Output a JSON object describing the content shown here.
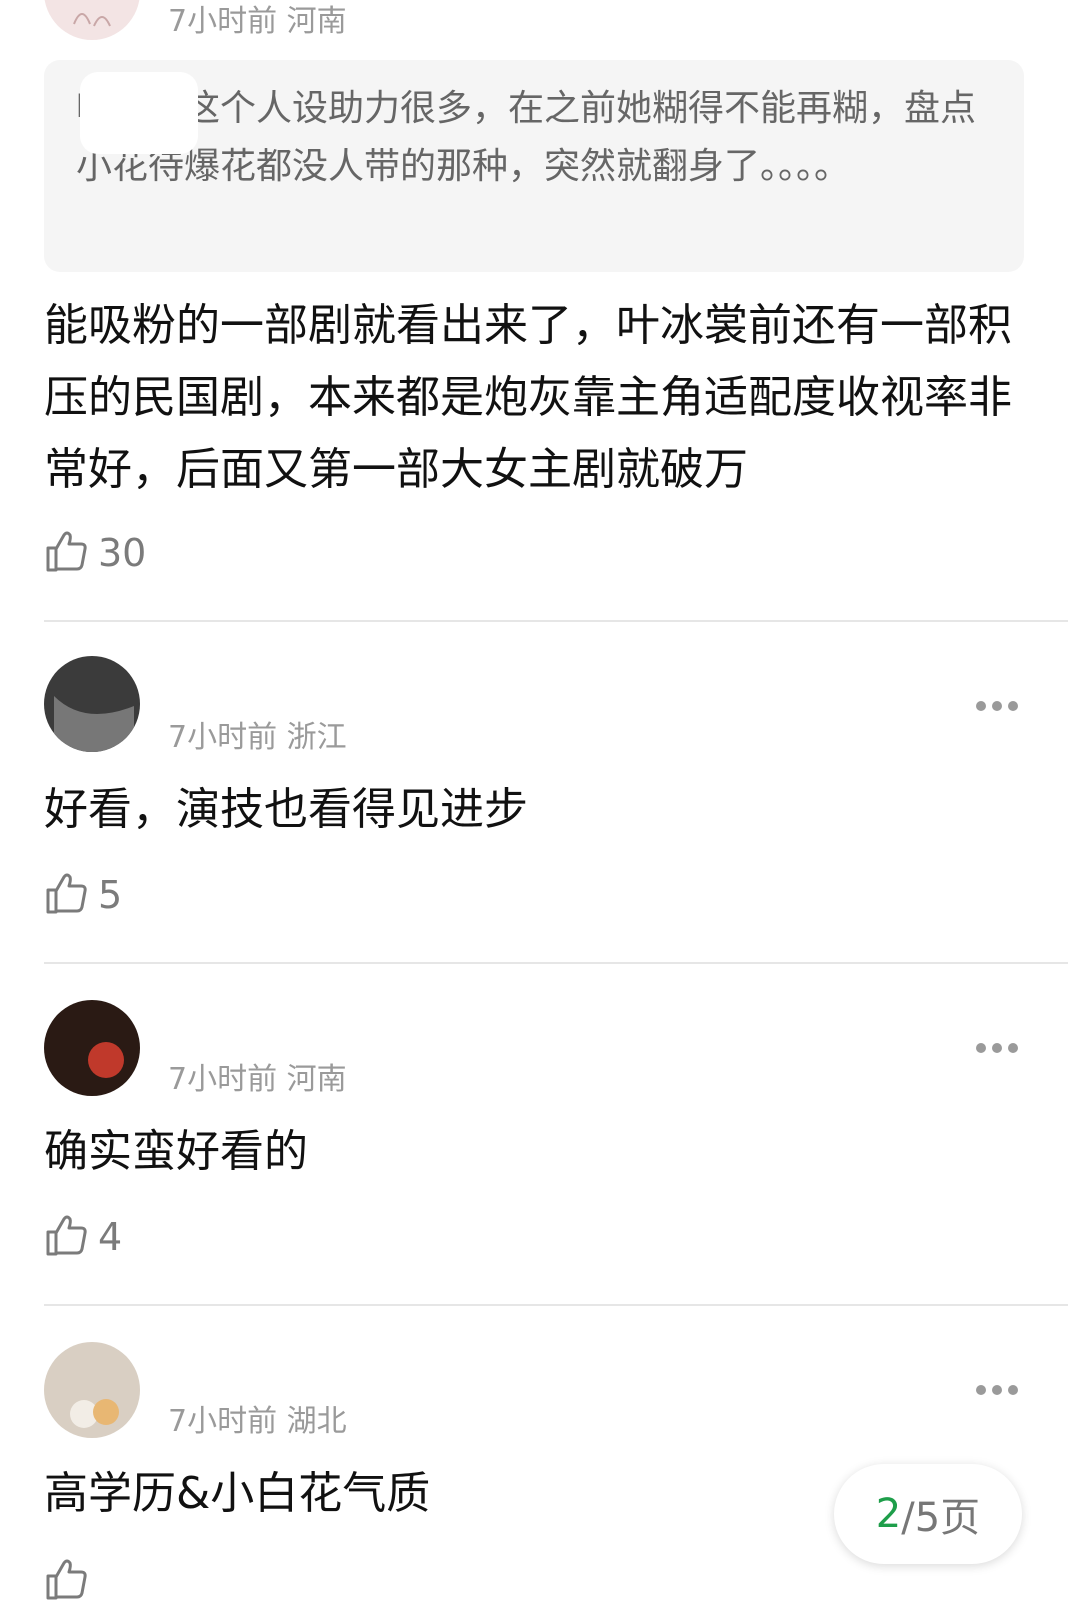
{
  "comments": [
    {
      "meta": "7小时前 河南",
      "quote": "叶冰裳这个人设助力很多，在之前她糊得不能再糊，盘点小花待爆花都没人带的那种，突然就翻身了。。。。",
      "text": "能吸粉的一部剧就看出来了，叶冰裳前还有一部积压的民国剧，本来都是炮灰靠主角适配度收视率非常好，后面又第一部大女主剧就破万",
      "likes": "30"
    },
    {
      "meta": "7小时前 浙江",
      "text": "好看，演技也看得见进步",
      "likes": "5"
    },
    {
      "meta": "7小时前 河南",
      "text": "确实蛮好看的",
      "likes": "4"
    },
    {
      "meta": "7小时前 湖北",
      "text": "高学历&小白花气质",
      "likes": ""
    }
  ],
  "pager": {
    "current": "2",
    "total": "/5页"
  },
  "colors": {
    "accent": "#1e9e4a",
    "meta": "#9a9a9a",
    "divider": "#e6e6e6"
  },
  "icons": {
    "like": "thumbs-up-icon",
    "more": "more-dots-icon"
  }
}
